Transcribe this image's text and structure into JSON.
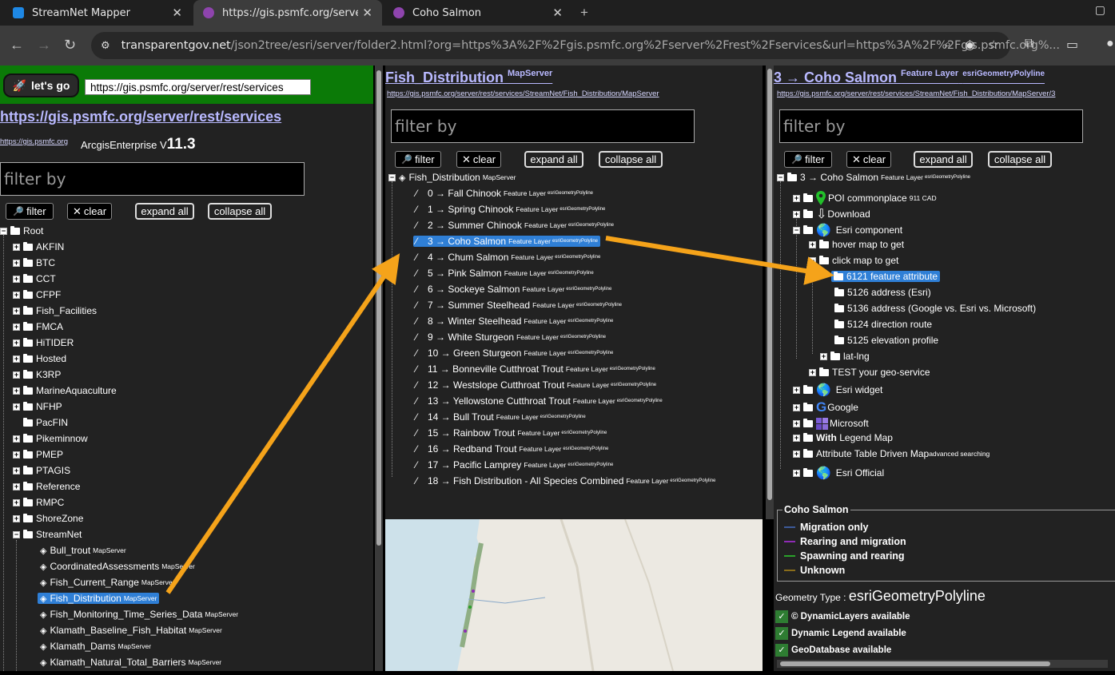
{
  "browser": {
    "tabs": [
      {
        "title": "StreamNet Mapper",
        "fav": "#1e88e5"
      },
      {
        "title": "https://gis.psmfc.org/server/rest",
        "fav": "#8e44ad"
      },
      {
        "title": "Coho Salmon",
        "fav": "#8e44ad"
      }
    ],
    "url_host": "transparentgov.net",
    "url_path": "/json2tree/esri/server/folder2.html?org=https%3A%2F%2Fgis.psmfc.org%2Fserver%2Frest%2Fservices&url=https%3A%2F%2Fgis.psmfc.org%..."
  },
  "left": {
    "go_label": "let's go",
    "url_value": "https://gis.psmfc.org/server/rest/services",
    "title": "https://gis.psmfc.org/server/rest/services",
    "org_link": "https://gis.psmfc.org",
    "product": "ArcgisEnterprise",
    "version_prefix": "V",
    "version": "11.3",
    "filter_placeholder": "filter by",
    "filter_label": "filter",
    "clear_label": "clear",
    "expand_label": "expand all",
    "collapse_label": "collapse all",
    "root_label": "Root",
    "folders": [
      "AKFIN",
      "BTC",
      "CCT",
      "CFPF",
      "Fish_Facilities",
      "FMCA",
      "HiTIDER",
      "Hosted",
      "K3RP",
      "MarineAquaculture",
      "NFHP",
      "PacFIN",
      "Pikeminnow",
      "PMEP",
      "PTAGIS",
      "Reference",
      "RMPC",
      "ShoreZone",
      "StreamNet"
    ],
    "services": [
      {
        "name": "Bull_trout",
        "type": "MapServer"
      },
      {
        "name": "CoordinatedAssessments",
        "type": "MapServer"
      },
      {
        "name": "Fish_Current_Range",
        "type": "MapServer"
      },
      {
        "name": "Fish_Distribution",
        "type": "MapServer"
      },
      {
        "name": "Fish_Monitoring_Time_Series_Data",
        "type": "MapServer"
      },
      {
        "name": "Klamath_Baseline_Fish_Habitat",
        "type": "MapServer"
      },
      {
        "name": "Klamath_Dams",
        "type": "MapServer"
      },
      {
        "name": "Klamath_Natural_Total_Barriers",
        "type": "MapServer"
      }
    ]
  },
  "middle": {
    "title": "Fish_Distribution",
    "title_sup": "MapServer",
    "link": "https://gis.psmfc.org/server/rest/services/StreamNet/Fish_Distribution/MapServer",
    "filter_placeholder": "filter by",
    "filter_label": "filter",
    "clear_label": "clear",
    "expand_label": "expand all",
    "collapse_label": "collapse all",
    "root_label": "Fish_Distribution",
    "root_sup": "MapServer",
    "layer_type": "Feature Layer",
    "geom_type": "esriGeometryPolyline",
    "layers": [
      "0 → Fall Chinook",
      "1 → Spring Chinook",
      "2 → Summer Chinook",
      "3 → Coho Salmon",
      "4 → Chum Salmon",
      "5 → Pink Salmon",
      "6 → Sockeye Salmon",
      "7 → Summer Steelhead",
      "8 → Winter Steelhead",
      "9 → White Sturgeon",
      "10 → Green Sturgeon",
      "11 → Bonneville Cutthroat Trout",
      "12 → Westslope Cutthroat Trout",
      "13 → Yellowstone Cutthroat Trout",
      "14 → Bull Trout",
      "15 → Rainbow Trout",
      "16 → Redband Trout",
      "17 → Pacific Lamprey",
      "18 → Fish Distribution - All Species Combined"
    ]
  },
  "right": {
    "title": "3 → Coho Salmon",
    "title_sup1": "Feature Layer",
    "title_sup2": "esriGeometryPolyline",
    "link": "https://gis.psmfc.org/server/rest/services/StreamNet/Fish_Distribution/MapServer/3",
    "filter_placeholder": "filter by",
    "filter_label": "filter",
    "clear_label": "clear",
    "expand_label": "expand all",
    "collapse_label": "collapse all",
    "root_label": "3 → Coho Salmon",
    "root_sup1": "Feature Layer",
    "root_sup2": "esriGeometryPolyline",
    "items": {
      "poi": "POI commonplace",
      "poi_sup": "911 CAD",
      "download": "Download",
      "esri_component": "Esri component",
      "hover": "hover map to get",
      "click": "click map to get",
      "attr": "6121 feature attribute",
      "addr_esri": "5126 address (Esri)",
      "addr_cmp": "5136 address (Google vs. Esri vs. Microsoft)",
      "route": "5124 direction route",
      "elev": "5125 elevation profile",
      "latlng": "lat-lng",
      "test": "TEST your geo-service",
      "widget": "Esri widget",
      "google": "Google",
      "microsoft": "Microsoft",
      "with_legend_b": "With",
      "with_legend": " Legend Map",
      "attr_table": "Attribute Table Driven Map",
      "attr_table_sup": "advanced searching",
      "official": "Esri Official"
    },
    "legend": {
      "title": "Coho Salmon",
      "entries": [
        {
          "label": "Migration only",
          "color": "#3d5a99"
        },
        {
          "label": "Rearing and migration",
          "color": "#8e2bb5"
        },
        {
          "label": "Spawning and rearing",
          "color": "#2aa22a"
        },
        {
          "label": "Unknown",
          "color": "#8a6d1a"
        }
      ]
    },
    "geometry_label": "Geometry Type : ",
    "geometry_value": "esriGeometryPolyline",
    "checks": [
      "© DynamicLayers available",
      "Dynamic Legend available",
      "GeoDatabase available"
    ]
  }
}
